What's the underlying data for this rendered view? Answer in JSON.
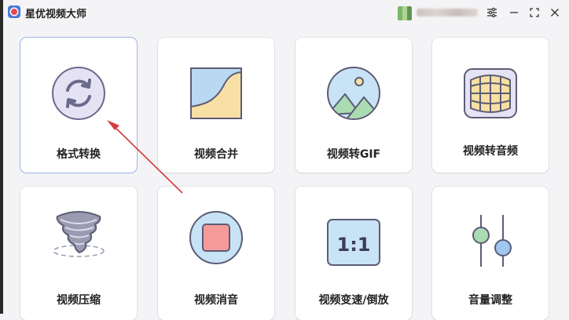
{
  "app": {
    "title": "星优视频大师"
  },
  "titlebar": {
    "buttons": [
      "settings-icon",
      "minimize-icon",
      "fullscreen-icon",
      "close-icon"
    ]
  },
  "tools": [
    {
      "id": "format-convert",
      "label": "格式转换",
      "icon": "convert-icon",
      "selected": true
    },
    {
      "id": "video-merge",
      "label": "视频合并",
      "icon": "merge-icon"
    },
    {
      "id": "video-to-gif",
      "label": "视频转GIF",
      "icon": "gif-icon"
    },
    {
      "id": "video-to-audio",
      "label": "视频转音频",
      "icon": "audio-icon"
    },
    {
      "id": "video-compress",
      "label": "视频压缩",
      "icon": "compress-icon"
    },
    {
      "id": "video-mute",
      "label": "视频消音",
      "icon": "mute-icon"
    },
    {
      "id": "video-speed-reverse",
      "label": "视频变速/倒放",
      "icon": "speed-icon",
      "icon_text": "1:1"
    },
    {
      "id": "volume-adjust",
      "label": "音量调整",
      "icon": "volume-slider-icon"
    }
  ],
  "colors": {
    "accent_purple": "#7e7fb8",
    "icon_fill": "#e4e2f3",
    "annotation_arrow": "#d63b3b",
    "stop_red": "#f59a9a"
  }
}
